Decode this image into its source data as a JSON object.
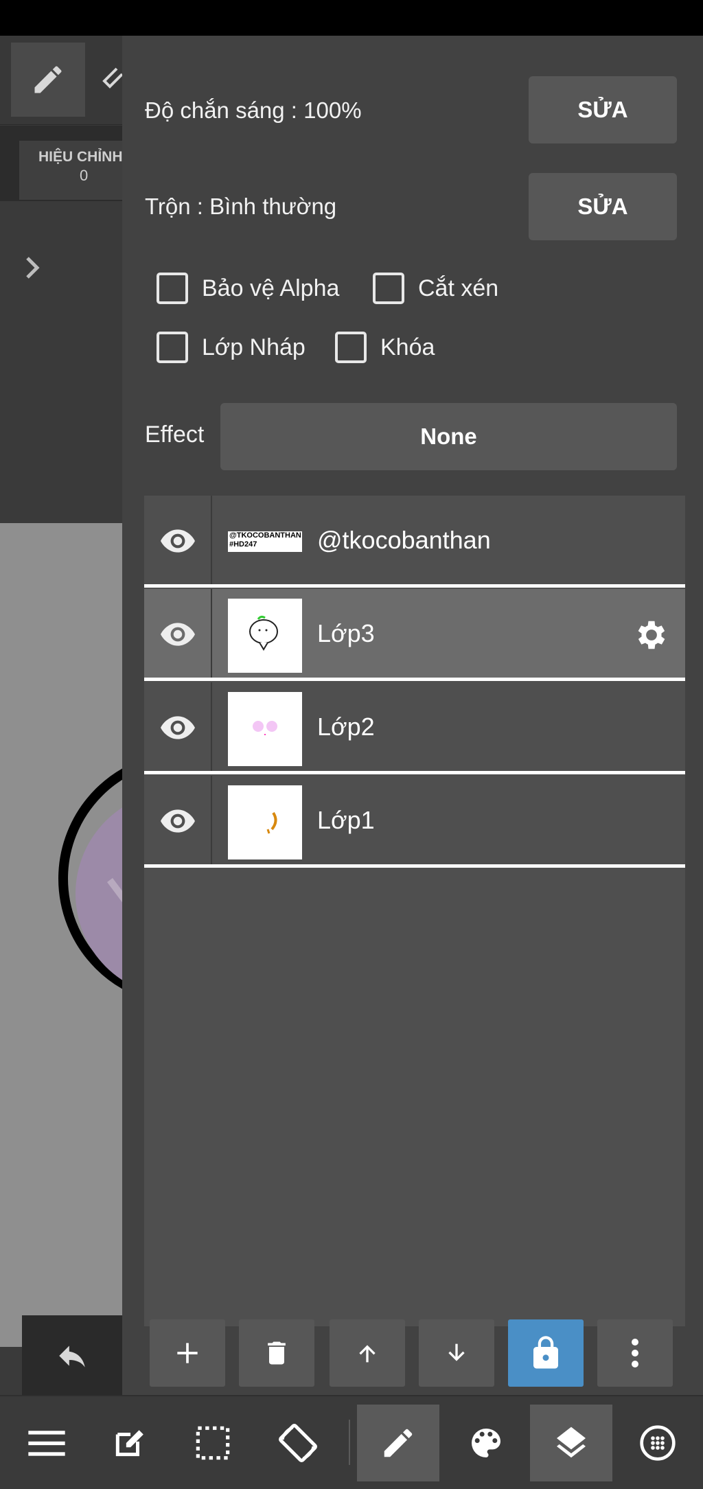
{
  "left_panel": {
    "adjust_label": "HIỆU CHỈNH",
    "adjust_value": "0"
  },
  "layer_properties": {
    "opacity_label": "Độ chắn sáng : 100%",
    "opacity_edit": "SỬA",
    "blend_label": "Trộn : Bình thường",
    "blend_edit": "SỬA",
    "checkboxes": [
      {
        "label": "Bảo vệ Alpha",
        "checked": false
      },
      {
        "label": "Cắt xén",
        "checked": false
      },
      {
        "label": "Lớp Nháp",
        "checked": false
      },
      {
        "label": "Khóa",
        "checked": false
      }
    ],
    "effect_label": "Effect",
    "effect_value": "None"
  },
  "layers": [
    {
      "name": "@tkocobanthan",
      "thumb_text": "@TKOCOBANTHAN #HD247",
      "visible": true,
      "selected": false
    },
    {
      "name": "Lớp3",
      "visible": true,
      "selected": true
    },
    {
      "name": "Lớp2",
      "visible": true,
      "selected": false
    },
    {
      "name": "Lớp1",
      "visible": true,
      "selected": false
    }
  ],
  "layer_toolbar": [
    "add-icon",
    "trash-icon",
    "arrow-up-icon",
    "arrow-down-icon",
    "lock-icon",
    "more-vertical-icon"
  ],
  "bottom_nav": [
    "menu-icon",
    "edit-canvas-icon",
    "selection-icon",
    "rotate-screen-icon",
    "pen-icon",
    "palette-icon",
    "layers-icon",
    "material-icon"
  ],
  "colors": {
    "panel_bg": "#424242",
    "button_bg": "#575757",
    "selected_layer": "#6c6c6c",
    "lock_active": "#4a8fc6"
  }
}
